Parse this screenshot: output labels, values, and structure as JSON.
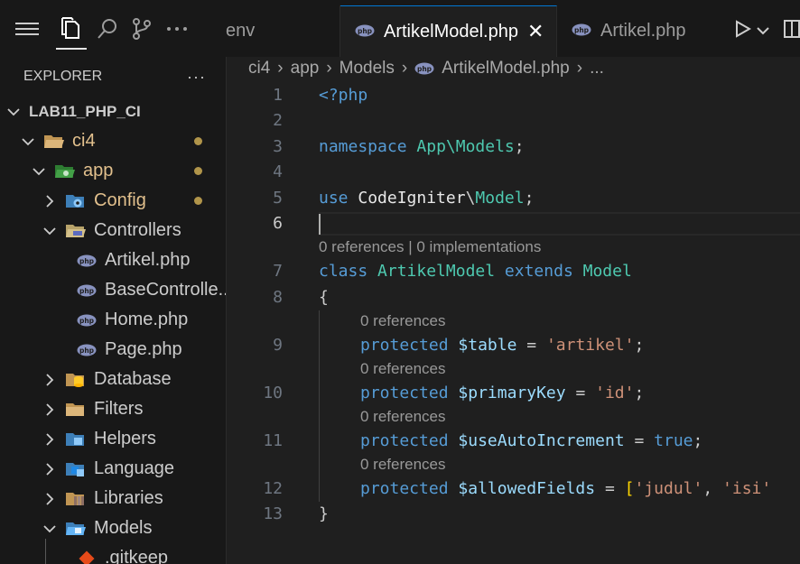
{
  "tabs": [
    {
      "label": "env",
      "active": false
    },
    {
      "label": "ArtikelModel.php",
      "active": true
    },
    {
      "label": "Artikel.php",
      "active": false
    }
  ],
  "explorer": {
    "title": "EXPLORER",
    "more": "···",
    "root": "LAB11_PHP_CI",
    "items": [
      {
        "label": "ci4",
        "icon": "folder-open-icon"
      },
      {
        "label": "app",
        "icon": "folder-app-icon"
      },
      {
        "label": "Config",
        "icon": "folder-config-icon"
      },
      {
        "label": "Controllers",
        "icon": "folder-controllers-icon"
      },
      {
        "label": "Artikel.php",
        "icon": "php-file-icon"
      },
      {
        "label": "BaseControlle...",
        "icon": "php-file-icon"
      },
      {
        "label": "Home.php",
        "icon": "php-file-icon"
      },
      {
        "label": "Page.php",
        "icon": "php-file-icon"
      },
      {
        "label": "Database",
        "icon": "folder-database-icon"
      },
      {
        "label": "Filters",
        "icon": "folder-filters-icon"
      },
      {
        "label": "Helpers",
        "icon": "folder-helpers-icon"
      },
      {
        "label": "Language",
        "icon": "folder-language-icon"
      },
      {
        "label": "Libraries",
        "icon": "folder-libraries-icon"
      },
      {
        "label": "Models",
        "icon": "folder-models-icon"
      },
      {
        "label": ".gitkeep",
        "icon": "git-file-icon"
      }
    ]
  },
  "breadcrumb": [
    "ci4",
    "app",
    "Models",
    "ArtikelModel.php",
    "..."
  ],
  "code": {
    "ln": [
      "1",
      "2",
      "3",
      "4",
      "5",
      "6",
      "7",
      "8",
      "9",
      "10",
      "11",
      "12",
      "13"
    ],
    "lens_class": "0 references | 0 implementations",
    "lens_prop": "0 references",
    "l1": "<?php",
    "l3_kw": "namespace",
    "l3_ns": "App\\Models",
    "l3_end": ";",
    "l5_kw": "use",
    "l5_a": "CodeIgniter",
    "l5_sep": "\\",
    "l5_b": "Model",
    "l5_end": ";",
    "l7_kw": "class",
    "l7_name": "ArtikelModel",
    "l7_ext": "extends",
    "l7_parent": "Model",
    "l8": "{",
    "prot": "protected",
    "l9_var": "$table",
    "l9_val": "'artikel'",
    "l10_var": "$primaryKey",
    "l10_val": "'id'",
    "l11_var": "$useAutoIncrement",
    "l11_val": "true",
    "l12_var": "$allowedFields",
    "l12_val1": "'judul'",
    "l12_val2": "'isi'",
    "eq": " = ",
    "semi": ";",
    "open_br": "[",
    "comma": ", ",
    "l13": "}"
  }
}
